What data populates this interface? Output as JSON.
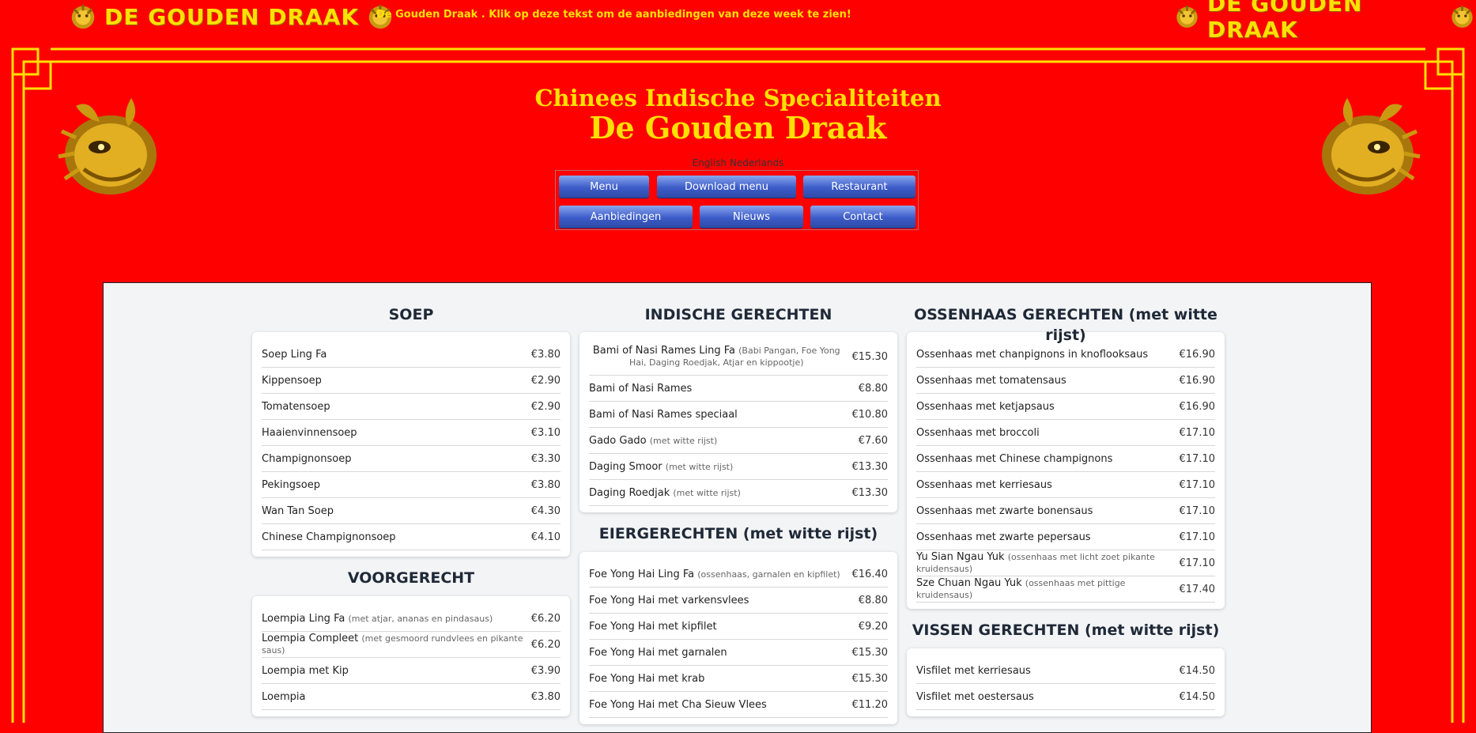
{
  "top": {
    "brand_left": "DE GOUDEN DRAAK",
    "brand_right": "DE GOUDEN DRAAK",
    "offer_text": "De Gouden Draak . Klik op deze tekst om de aanbiedingen van deze week te zien!"
  },
  "header": {
    "subtitle": "Chinees Indische Specialiteiten",
    "title": "De Gouden Draak"
  },
  "language": {
    "english": "English",
    "dutch": "Nederlands"
  },
  "nav": {
    "row1": [
      "Menu",
      "Download menu",
      "Restaurant"
    ],
    "row2": [
      "Aanbiedingen",
      "Nieuws",
      "Contact"
    ]
  },
  "colors": {
    "background": "#ff0000",
    "gold": "#ffe000",
    "button": "#3c5cc8"
  },
  "menu": {
    "soep": {
      "title": "SOEP",
      "items": [
        {
          "name": "Soep Ling Fa",
          "desc": "",
          "price": "€3.80"
        },
        {
          "name": "Kippensoep",
          "desc": "",
          "price": "€2.90"
        },
        {
          "name": "Tomatensoep",
          "desc": "",
          "price": "€2.90"
        },
        {
          "name": "Haaienvinnensoep",
          "desc": "",
          "price": "€3.10"
        },
        {
          "name": "Champignonsoep",
          "desc": "",
          "price": "€3.30"
        },
        {
          "name": "Pekingsoep",
          "desc": "",
          "price": "€3.80"
        },
        {
          "name": "Wan Tan Soep",
          "desc": "",
          "price": "€4.30"
        },
        {
          "name": "Chinese Champignonsoep",
          "desc": "",
          "price": "€4.10"
        }
      ]
    },
    "voorgerecht": {
      "title": "VOORGERECHT",
      "items": [
        {
          "name": "Loempia Ling Fa",
          "desc": "(met atjar, ananas en pindasaus)",
          "price": "€6.20"
        },
        {
          "name": "Loempia Compleet",
          "desc": "(met gesmoord rundvlees en pikante saus)",
          "price": "€6.20"
        },
        {
          "name": "Loempia met Kip",
          "desc": "",
          "price": "€3.90"
        },
        {
          "name": "Loempia",
          "desc": "",
          "price": "€3.80"
        }
      ]
    },
    "indisch": {
      "title": "INDISCHE GERECHTEN",
      "items": [
        {
          "name": "Bami of Nasi Rames Ling Fa",
          "desc": "(Babi Pangan, Foe Yong Hai, Daging Roedjak, Atjar en kippootje)",
          "price": "€15.30"
        },
        {
          "name": "Bami of Nasi Rames",
          "desc": "",
          "price": "€8.80"
        },
        {
          "name": "Bami of Nasi Rames speciaal",
          "desc": "",
          "price": "€10.80"
        },
        {
          "name": "Gado Gado",
          "desc": "(met witte rijst)",
          "price": "€7.60"
        },
        {
          "name": "Daging Smoor",
          "desc": "(met witte rijst)",
          "price": "€13.30"
        },
        {
          "name": "Daging Roedjak",
          "desc": "(met witte rijst)",
          "price": "€13.30"
        }
      ]
    },
    "eier": {
      "title": "EIERGERECHTEN (met witte rijst)",
      "items": [
        {
          "name": "Foe Yong Hai Ling Fa",
          "desc": "(ossenhaas, garnalen en kipfilet)",
          "price": "€16.40"
        },
        {
          "name": "Foe Yong Hai met varkensvlees",
          "desc": "",
          "price": "€8.80"
        },
        {
          "name": "Foe Yong Hai met kipfilet",
          "desc": "",
          "price": "€9.20"
        },
        {
          "name": "Foe Yong Hai met garnalen",
          "desc": "",
          "price": "€15.30"
        },
        {
          "name": "Foe Yong Hai met krab",
          "desc": "",
          "price": "€15.30"
        },
        {
          "name": "Foe Yong Hai met Cha Sieuw Vlees",
          "desc": "",
          "price": "€11.20"
        }
      ]
    },
    "ossenhaas": {
      "title": "OSSENHAAS GERECHTEN (met witte rijst)",
      "items": [
        {
          "name": "Ossenhaas met chanpignons in knoflooksaus",
          "desc": "",
          "price": "€16.90"
        },
        {
          "name": "Ossenhaas met tomatensaus",
          "desc": "",
          "price": "€16.90"
        },
        {
          "name": "Ossenhaas met ketjapsaus",
          "desc": "",
          "price": "€16.90"
        },
        {
          "name": "Ossenhaas met broccoli",
          "desc": "",
          "price": "€17.10"
        },
        {
          "name": "Ossenhaas met Chinese champignons",
          "desc": "",
          "price": "€17.10"
        },
        {
          "name": "Ossenhaas met kerriesaus",
          "desc": "",
          "price": "€17.10"
        },
        {
          "name": "Ossenhaas met zwarte bonensaus",
          "desc": "",
          "price": "€17.10"
        },
        {
          "name": "Ossenhaas met zwarte pepersaus",
          "desc": "",
          "price": "€17.10"
        },
        {
          "name": "Yu Sian Ngau Yuk",
          "desc": "(ossenhaas met licht zoet pikante kruidensaus)",
          "price": "€17.10"
        },
        {
          "name": "Sze Chuan Ngau Yuk",
          "desc": "(ossenhaas met pittige kruidensaus)",
          "price": "€17.40"
        }
      ]
    },
    "vis": {
      "title": "VISSEN GERECHTEN (met witte rijst)",
      "items": [
        {
          "name": "Visfilet met kerriesaus",
          "desc": "",
          "price": "€14.50"
        },
        {
          "name": "Visfilet met oestersaus",
          "desc": "",
          "price": "€14.50"
        }
      ]
    }
  }
}
